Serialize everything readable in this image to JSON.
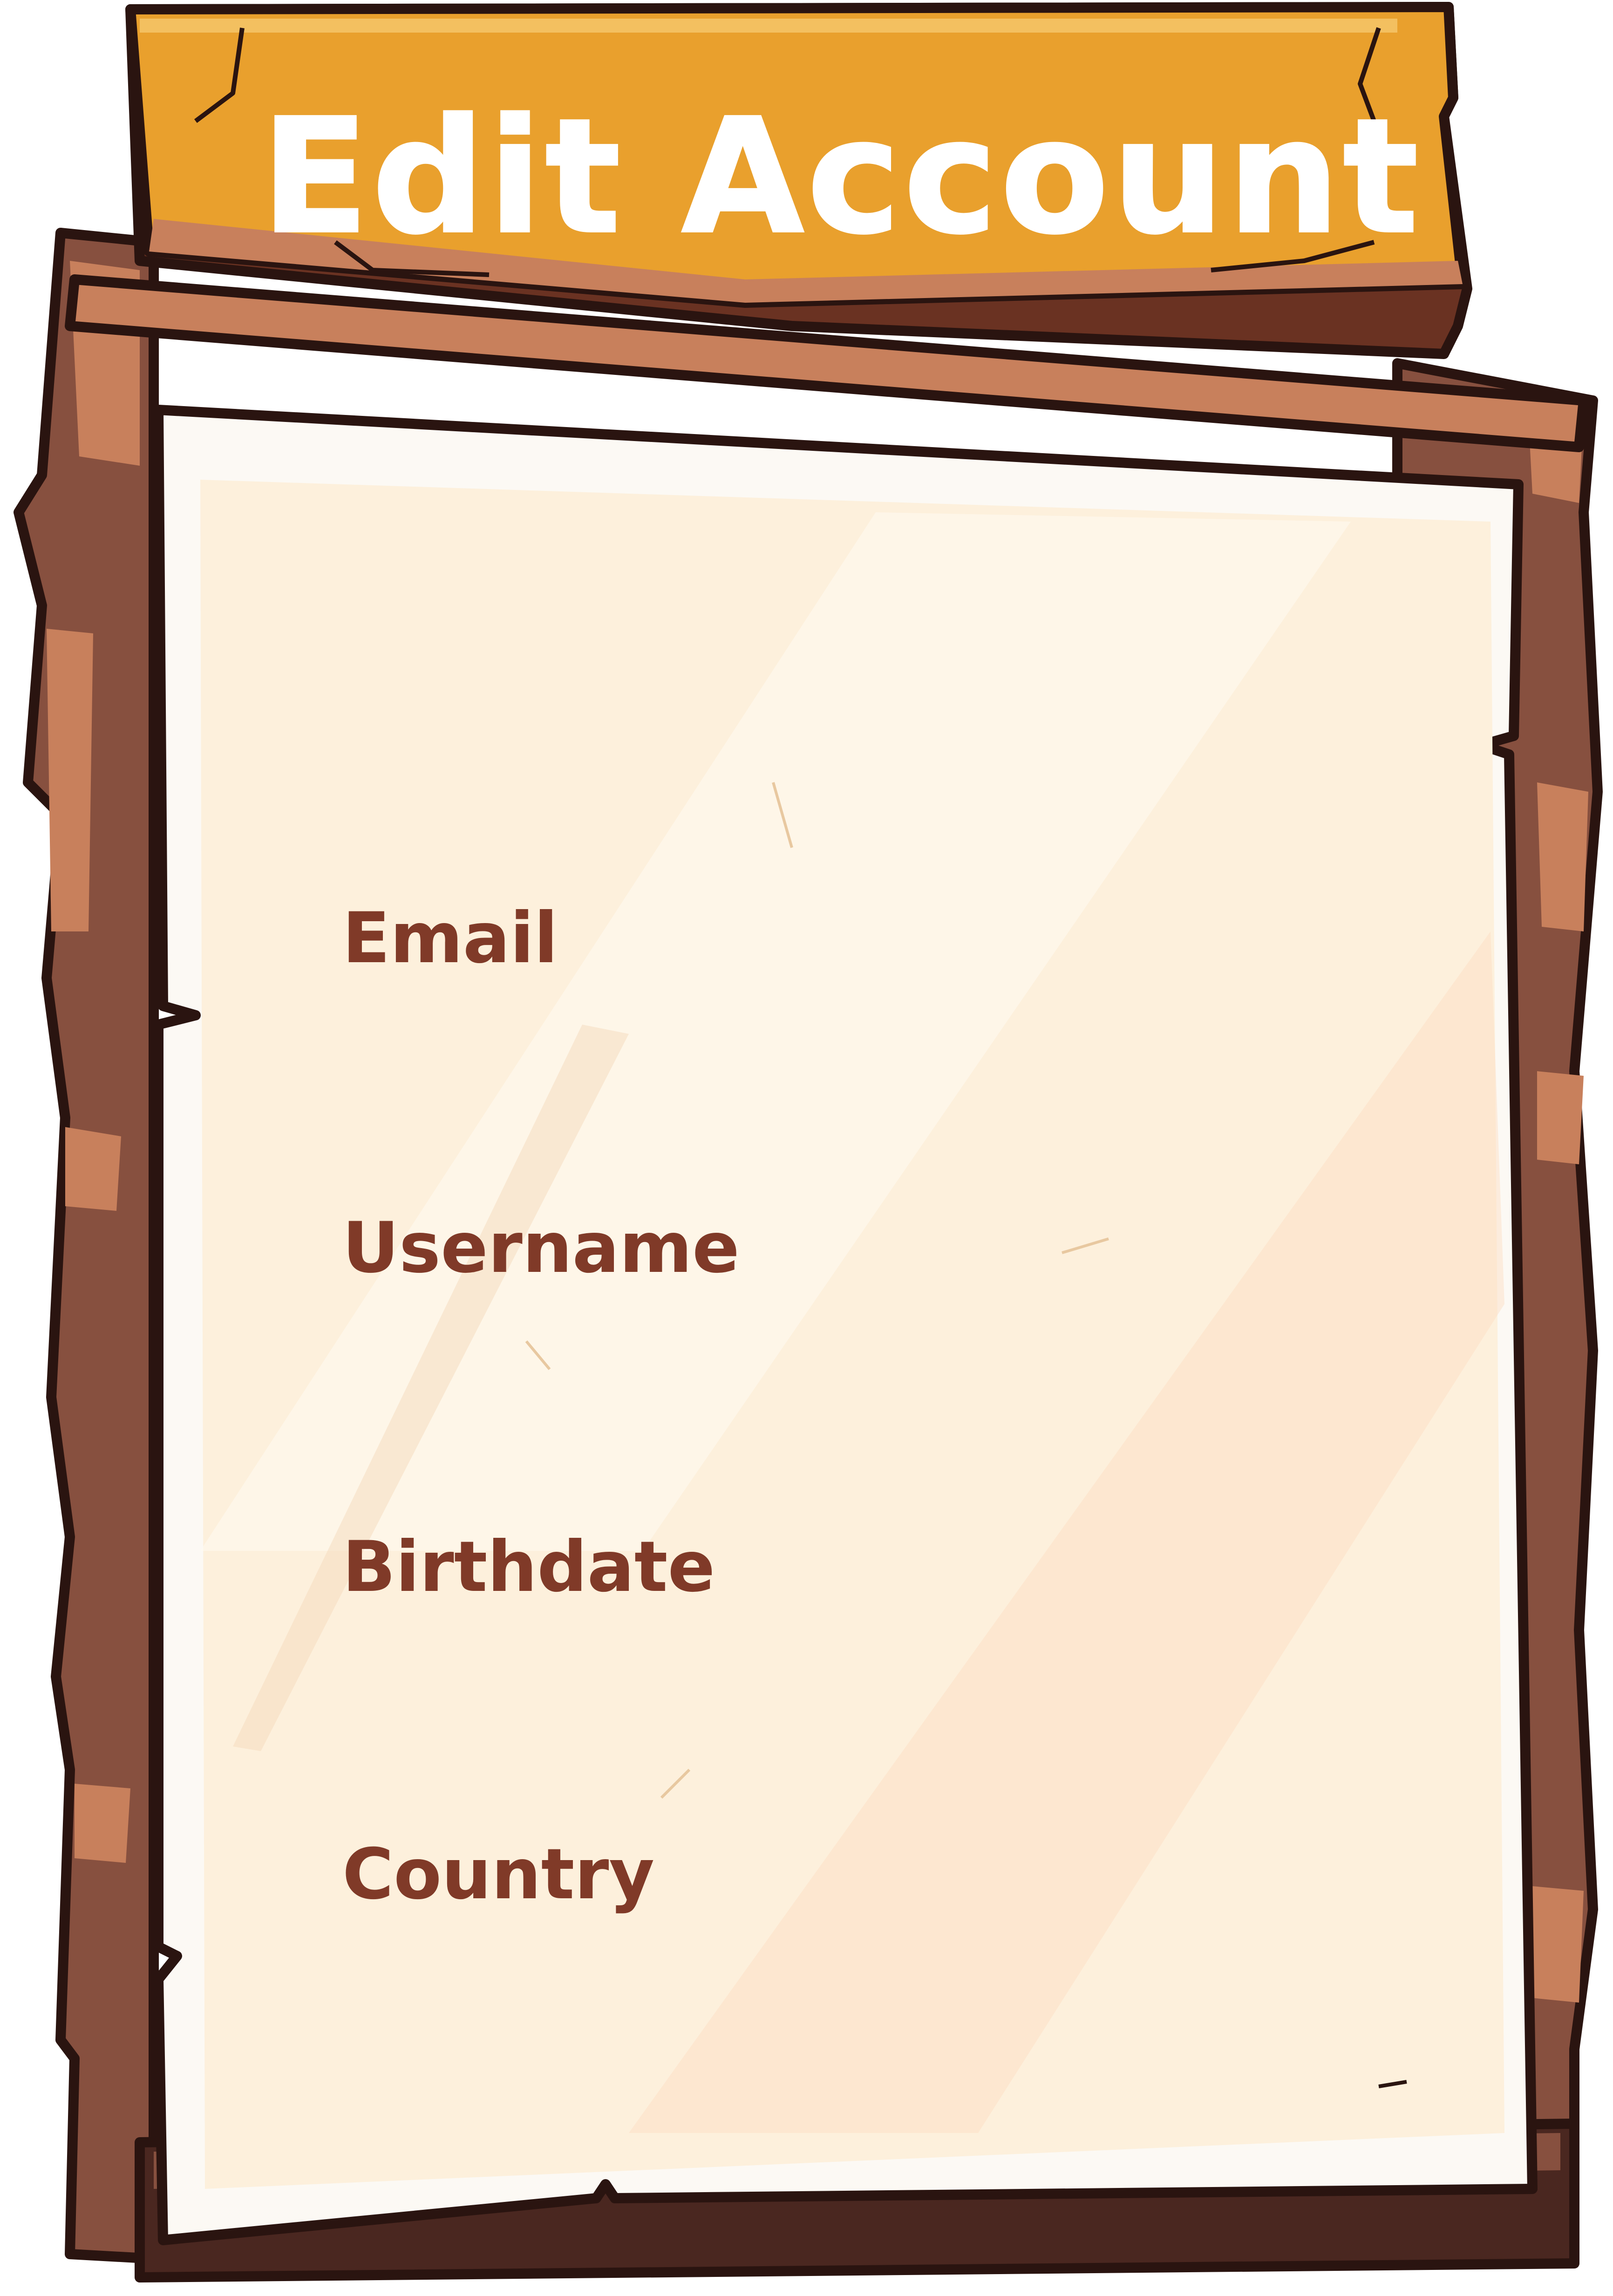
{
  "title": "Edit Account",
  "fields": [
    {
      "label": "Email"
    },
    {
      "label": "Username"
    },
    {
      "label": "Birthdate"
    },
    {
      "label": "Country"
    }
  ],
  "colors": {
    "wood_dark": "#4a2720",
    "wood_mid": "#87503f",
    "wood_light": "#c8805c",
    "sign_orange": "#e9a02d",
    "sign_shadow": "#6a3222",
    "paper": "#fdf0dc",
    "paper_edge": "#fcf9f4",
    "label": "#803a28",
    "outline": "#2a1410",
    "title_text": "#ffffff"
  }
}
